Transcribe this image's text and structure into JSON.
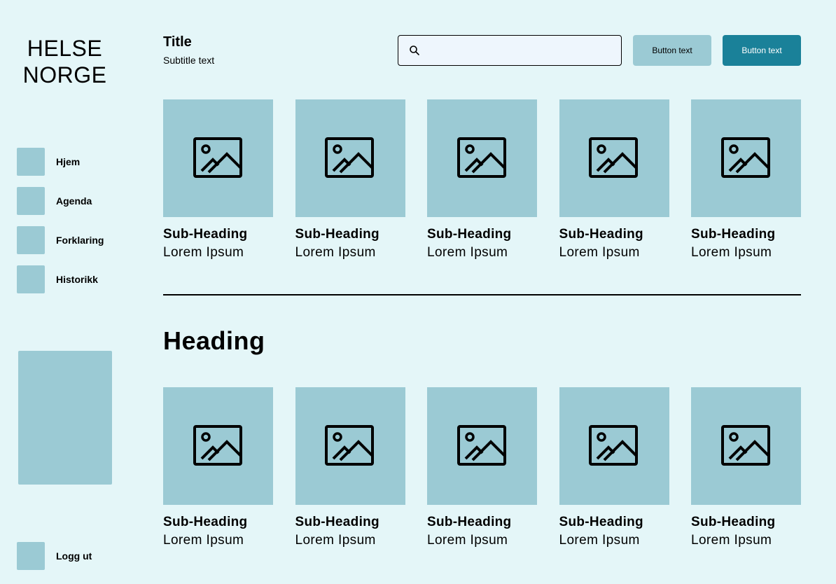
{
  "logo": {
    "line1": "HELSE",
    "line2": "NORGE"
  },
  "sidebar": {
    "items": [
      {
        "label": "Hjem"
      },
      {
        "label": "Agenda"
      },
      {
        "label": "Forklaring"
      },
      {
        "label": "Historikk"
      }
    ],
    "logout_label": "Logg ut"
  },
  "header": {
    "title": "Title",
    "subtitle": "Subtitle text",
    "search": {
      "value": "",
      "placeholder": ""
    },
    "secondary_button": "Button text",
    "primary_button": "Button text"
  },
  "section1": {
    "cards": [
      {
        "sub_heading": "Sub-Heading",
        "text": "Lorem Ipsum"
      },
      {
        "sub_heading": "Sub-Heading",
        "text": "Lorem Ipsum"
      },
      {
        "sub_heading": "Sub-Heading",
        "text": "Lorem Ipsum"
      },
      {
        "sub_heading": "Sub-Heading",
        "text": "Lorem Ipsum"
      },
      {
        "sub_heading": "Sub-Heading",
        "text": "Lorem Ipsum"
      }
    ]
  },
  "section2": {
    "heading": "Heading",
    "cards": [
      {
        "sub_heading": "Sub-Heading",
        "text": "Lorem Ipsum"
      },
      {
        "sub_heading": "Sub-Heading",
        "text": "Lorem Ipsum"
      },
      {
        "sub_heading": "Sub-Heading",
        "text": "Lorem Ipsum"
      },
      {
        "sub_heading": "Sub-Heading",
        "text": "Lorem Ipsum"
      },
      {
        "sub_heading": "Sub-Heading",
        "text": "Lorem Ipsum"
      }
    ]
  },
  "colors": {
    "background": "#e4f6f8",
    "tile": "#9bcad4",
    "primary": "#1a8199"
  },
  "icons": {
    "card_image": "image-placeholder-icon",
    "search": "search-icon"
  }
}
